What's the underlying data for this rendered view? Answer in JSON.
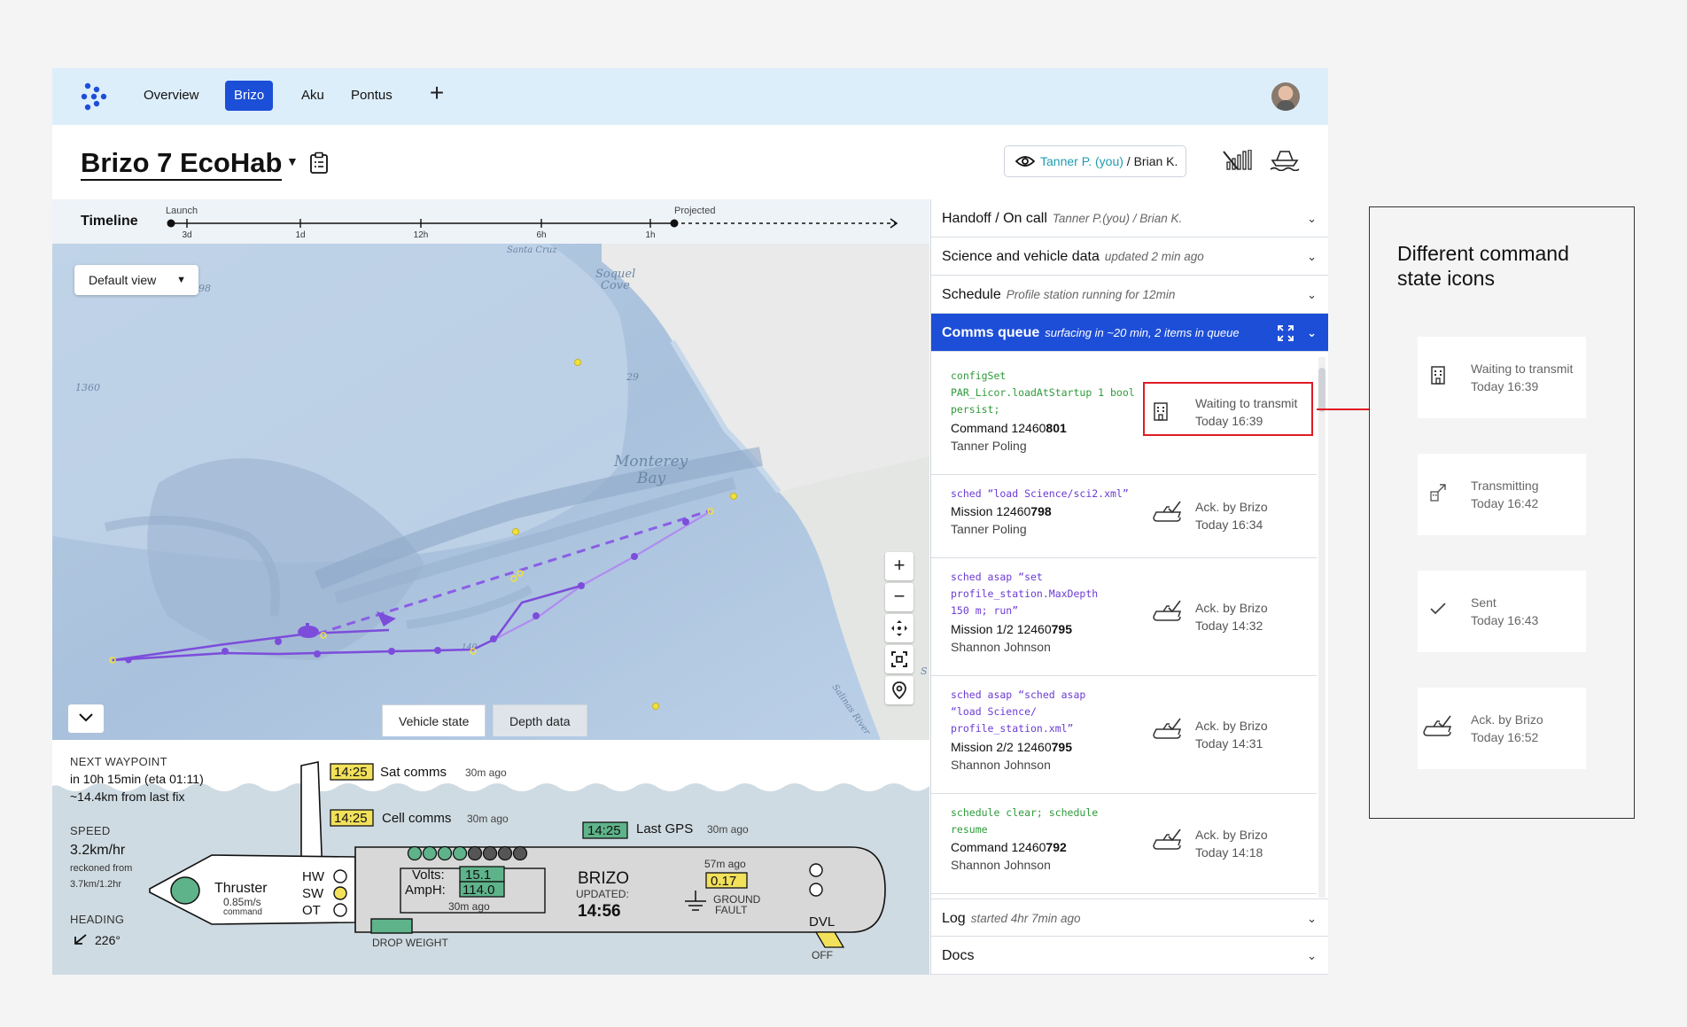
{
  "nav": {
    "tabs": [
      "Overview",
      "Brizo",
      "Aku",
      "Pontus"
    ],
    "active_tab": "Brizo",
    "add_label": "+"
  },
  "header": {
    "title": "Brizo 7 EcoHab",
    "viewer_self": "Tanner P. (you)",
    "viewer_sep": " / ",
    "viewer_other": "Brian K."
  },
  "timeline": {
    "label": "Timeline",
    "marker_top_left": "Launch",
    "marker_top_right": "Projected",
    "ticks": [
      "3d",
      "1d",
      "12h",
      "6h",
      "1h"
    ]
  },
  "map": {
    "default_view": "Default view",
    "labels": {
      "santa_cruz": "Santa Cruz",
      "soquel_cove_1": "Soquel",
      "soquel_cove_2": "Cove",
      "monterey_1": "Monterey",
      "monterey_2": "Bay",
      "depth_1360": "1360",
      "depth_29": "29",
      "depth_98": "98",
      "salinas_river": "Salinas River",
      "depth_140": "140",
      "s_label": "S"
    },
    "zoom_in": "+",
    "zoom_out": "−",
    "tabs": {
      "vehicle_state": "Vehicle state",
      "depth_data": "Depth data"
    }
  },
  "vehicle_state": {
    "next_waypoint_label": "NEXT WAYPOINT",
    "next_waypoint_eta": "in 10h 15min (eta 01:11)",
    "next_waypoint_dist": "~14.4km from last fix",
    "speed_label": "SPEED",
    "speed_value": "3.2km/hr",
    "speed_note_1": "reckoned from",
    "speed_note_2": "3.7km/1.2hr",
    "heading_label": "HEADING",
    "heading_value": "226°",
    "sat_time": "14:25",
    "sat_label": "Sat comms",
    "sat_ago": "30m ago",
    "cell_time": "14:25",
    "cell_label": "Cell comms",
    "cell_ago": "30m ago",
    "gps_time": "14:25",
    "gps_label": "Last GPS",
    "gps_ago": "30m ago",
    "thruster_label": "Thruster",
    "thruster_speed": "0.85m/s",
    "thruster_note": "command",
    "hw": "HW",
    "sw": "SW",
    "ot": "OT",
    "volts_label": "Volts:",
    "volts_value": "15.1",
    "amph_label": "AmpH:",
    "amph_value": "114.0",
    "battery_ago": "30m ago",
    "name": "BRIZO",
    "updated_label": "UPDATED:",
    "updated_time": "14:56",
    "fault_ago": "57m ago",
    "fault_value": "0.17",
    "fault_label_1": "GROUND",
    "fault_label_2": "FAULT",
    "dvl": "DVL",
    "dvl_state": "OFF",
    "drop_weight": "DROP WEIGHT"
  },
  "panel": {
    "handoff": {
      "title": "Handoff / On call",
      "sub": "Tanner P.(you) / Brian K."
    },
    "science": {
      "title": "Science and vehicle data",
      "sub": "updated 2 min ago"
    },
    "schedule": {
      "title": "Schedule",
      "sub": "Profile station running for 12min"
    },
    "comms": {
      "title": "Comms queue",
      "sub": "surfacing in ~20 min, 2 items in queue"
    },
    "log": {
      "title": "Log",
      "sub": "started 4hr 7min ago"
    },
    "docs": {
      "title": "Docs"
    }
  },
  "queue": [
    {
      "code": [
        "configSet",
        "PAR_Licor.loadAtStartup 1 bool",
        "persist;"
      ],
      "kind": "Command 12460",
      "num": "801",
      "who": "Tanner Poling",
      "status": "Waiting to transmit",
      "time": "Today 16:39"
    },
    {
      "code": [
        "sched “load Science/sci2.xml”"
      ],
      "kind": "Mission 12460",
      "num": "798",
      "who": "Tanner Poling",
      "status": "Ack. by Brizo",
      "time": "Today 16:34"
    },
    {
      "code": [
        "sched asap “set",
        "profile_station.MaxDepth",
        "150 m; run”"
      ],
      "kind": "Mission 1/2 12460",
      "num": "795",
      "who": "Shannon Johnson",
      "status": "Ack. by Brizo",
      "time": "Today 14:32"
    },
    {
      "code": [
        "sched asap “sched asap",
        "“load Science/",
        "profile_station.xml”"
      ],
      "kind": "Mission 2/2 12460",
      "num": "795",
      "who": "Shannon Johnson",
      "status": "Ack. by Brizo",
      "time": "Today 14:31"
    },
    {
      "code": [
        "schedule clear; schedule",
        "resume"
      ],
      "kind": "Command 12460",
      "num": "792",
      "who": "Shannon Johnson",
      "status": "Ack. by Brizo",
      "time": "Today 14:18"
    }
  ],
  "legend": {
    "title": "Different command state icons",
    "items": [
      {
        "status": "Waiting to transmit",
        "time": "Today 16:39",
        "icon": "building-icon"
      },
      {
        "status": "Transmitting",
        "time": "Today 16:42",
        "icon": "transmitting-icon"
      },
      {
        "status": "Sent",
        "time": "Today 16:43",
        "icon": "check-icon"
      },
      {
        "status": "Ack. by Brizo",
        "time": "Today 16:52",
        "icon": "ack-boat-icon"
      }
    ]
  },
  "colors": {
    "accent": "#1d4ed8",
    "nav_bg": "#ddeefb",
    "code_green": "#2e9a3a",
    "code_purple": "#6b3bd4",
    "track": "#7c4ddb",
    "highlight": "#e01b24",
    "comms_yellow": "#f2e15a",
    "battery_green": "#5fb38a"
  }
}
